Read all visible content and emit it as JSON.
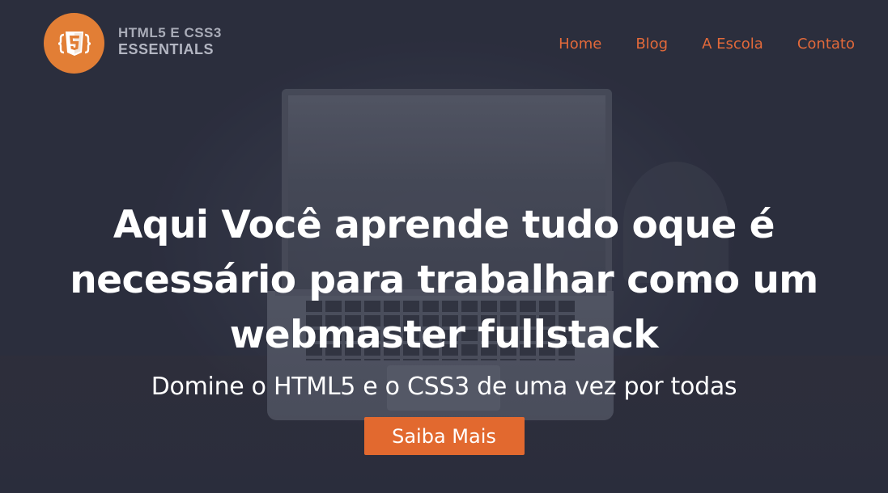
{
  "brand": {
    "logo_icon": "html5-badge-icon",
    "name_line1": "HTML5 E CSS3",
    "name_line2": "ESSENTIALS",
    "accent_color": "#e27e35"
  },
  "nav": {
    "items": [
      {
        "label": "Home"
      },
      {
        "label": "Blog"
      },
      {
        "label": "A Escola"
      },
      {
        "label": "Contato"
      }
    ],
    "link_color": "#e2693a"
  },
  "hero": {
    "title_line1": "Aqui Você aprende tudo oque é",
    "title_line2": "necessário para trabalhar como um",
    "title_line3": "webmaster fullstack",
    "subtitle": "Domine o HTML5 e o CSS3 de uma vez por todas",
    "cta_label": "Saiba Mais",
    "cta_color": "#e2692f",
    "background": "laptop-photo"
  }
}
